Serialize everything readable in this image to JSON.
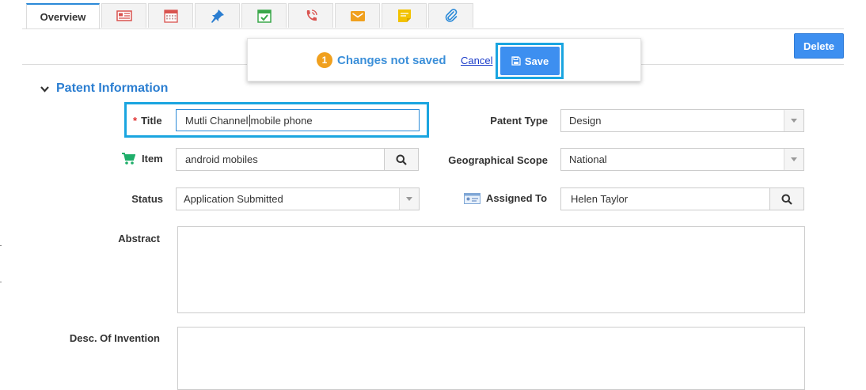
{
  "tabs": [
    {
      "label": "Overview",
      "active": true
    },
    {
      "icon": "newspaper-icon",
      "color": "#d9534f"
    },
    {
      "icon": "calendar-icon",
      "color": "#d9534f"
    },
    {
      "icon": "pin-icon",
      "color": "#2b7ed1"
    },
    {
      "icon": "calendar-check-icon",
      "color": "#3aa84a"
    },
    {
      "icon": "phone-icon",
      "color": "#d9534f"
    },
    {
      "icon": "envelope-icon",
      "color": "#f0a01e"
    },
    {
      "icon": "sticky-note-icon",
      "color": "#f2c200"
    },
    {
      "icon": "paperclip-icon",
      "color": "#2b8ad8"
    }
  ],
  "toolbar": {
    "delete_label": "Delete",
    "unsaved_count": "1",
    "unsaved_text": "Changes not saved",
    "cancel_label": "Cancel",
    "save_label": "Save"
  },
  "section": {
    "title": "Patent Information"
  },
  "form": {
    "title": {
      "label": "Title",
      "required": true,
      "value_before_cursor": "Mutli Channel",
      "value_after_cursor": "mobile phone"
    },
    "patent_type": {
      "label": "Patent Type",
      "value": "Design"
    },
    "item": {
      "label": "Item",
      "value": "android mobiles",
      "icon": "cart-icon"
    },
    "geographical_scope": {
      "label": "Geographical Scope",
      "value": "National"
    },
    "status": {
      "label": "Status",
      "value": "Application Submitted"
    },
    "assigned_to": {
      "label": "Assigned To",
      "value": "Helen Taylor",
      "icon": "id-card-icon"
    },
    "abstract": {
      "label": "Abstract",
      "value": ""
    },
    "desc_of_invention": {
      "label": "Desc. Of Invention",
      "value": ""
    }
  },
  "colors": {
    "accent": "#2b8ad8",
    "button": "#3d8ff0",
    "highlight": "#1aa5e0",
    "badge": "#f0a01e",
    "required": "#e03030"
  }
}
